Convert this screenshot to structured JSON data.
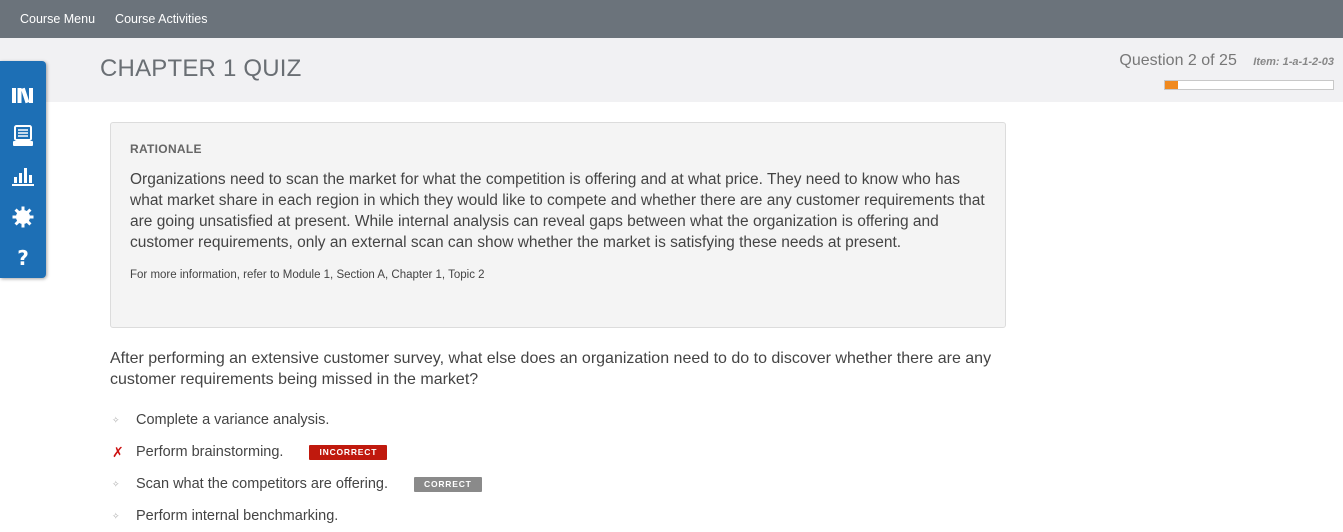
{
  "topnav": {
    "items": [
      "Course Menu",
      "Course Activities"
    ]
  },
  "header": {
    "title": "CHAPTER 1 QUIZ",
    "question_count": "Question 2 of 25",
    "item_id": "Item: 1-a-1-2-03",
    "progress_fraction": 0.08,
    "progress_color": "#f0891e"
  },
  "sidebar": {
    "icons": [
      "library-icon",
      "notebook-icon",
      "bar-chart-icon",
      "gear-icon",
      "help-icon"
    ],
    "accent": "#1d6fb5"
  },
  "rationale": {
    "heading": "RATIONALE",
    "body": "Organizations need to scan the market for what the competition is offering and at what price. They need to know who has what market share in each region in which they would like to compete and whether there are any customer requirements that are going unsatisfied at present. While internal analysis can reveal gaps between what the organization is offering and customer requirements, only an external scan can show whether the market is satisfying these needs at present.",
    "reference": "For more information, refer to Module 1, Section A, Chapter 1, Topic 2"
  },
  "question": {
    "text": "After performing an extensive customer survey, what else does an organization need to do to discover whether there are any customer requirements being missed in the market?",
    "answers": [
      {
        "text": "Complete a variance analysis.",
        "marker": "✧",
        "status": ""
      },
      {
        "text": "Perform brainstorming.",
        "marker": "✗",
        "status": "INCORRECT"
      },
      {
        "text": "Scan what the competitors are offering.",
        "marker": "✧",
        "status": "CORRECT"
      },
      {
        "text": "Perform internal benchmarking.",
        "marker": "✧",
        "status": ""
      }
    ]
  }
}
